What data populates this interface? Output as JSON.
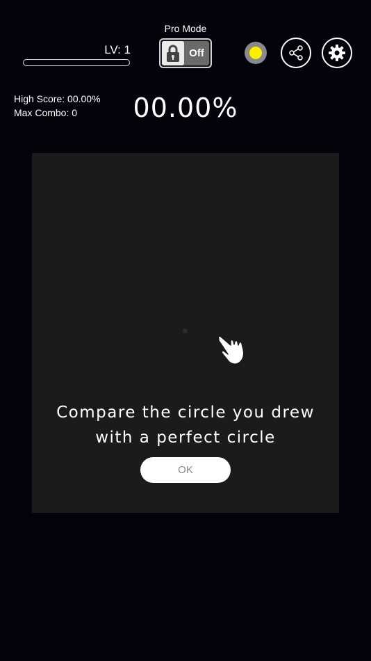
{
  "header": {
    "level_label": "LV: 1",
    "xp_progress": 0.0,
    "pro_mode_label": "Pro Mode",
    "pro_mode_state": "Off",
    "pro_mode_icon": "lock-icon",
    "color_picker_color": "#ffee00",
    "share_icon": "share-icon",
    "settings_icon": "gear-icon"
  },
  "stats": {
    "high_score": "High Score: 00.00%",
    "max_combo": "Max Combo: 0",
    "current_percent": "00.00%"
  },
  "tutorial": {
    "line1": "Compare the circle you drew",
    "line2": "with a perfect circle",
    "ok_label": "OK",
    "hand_icon": "pointing-hand-icon"
  },
  "colors": {
    "background": "#03030c",
    "play_area": "#1b1b1b",
    "accent": "#ffee00"
  }
}
